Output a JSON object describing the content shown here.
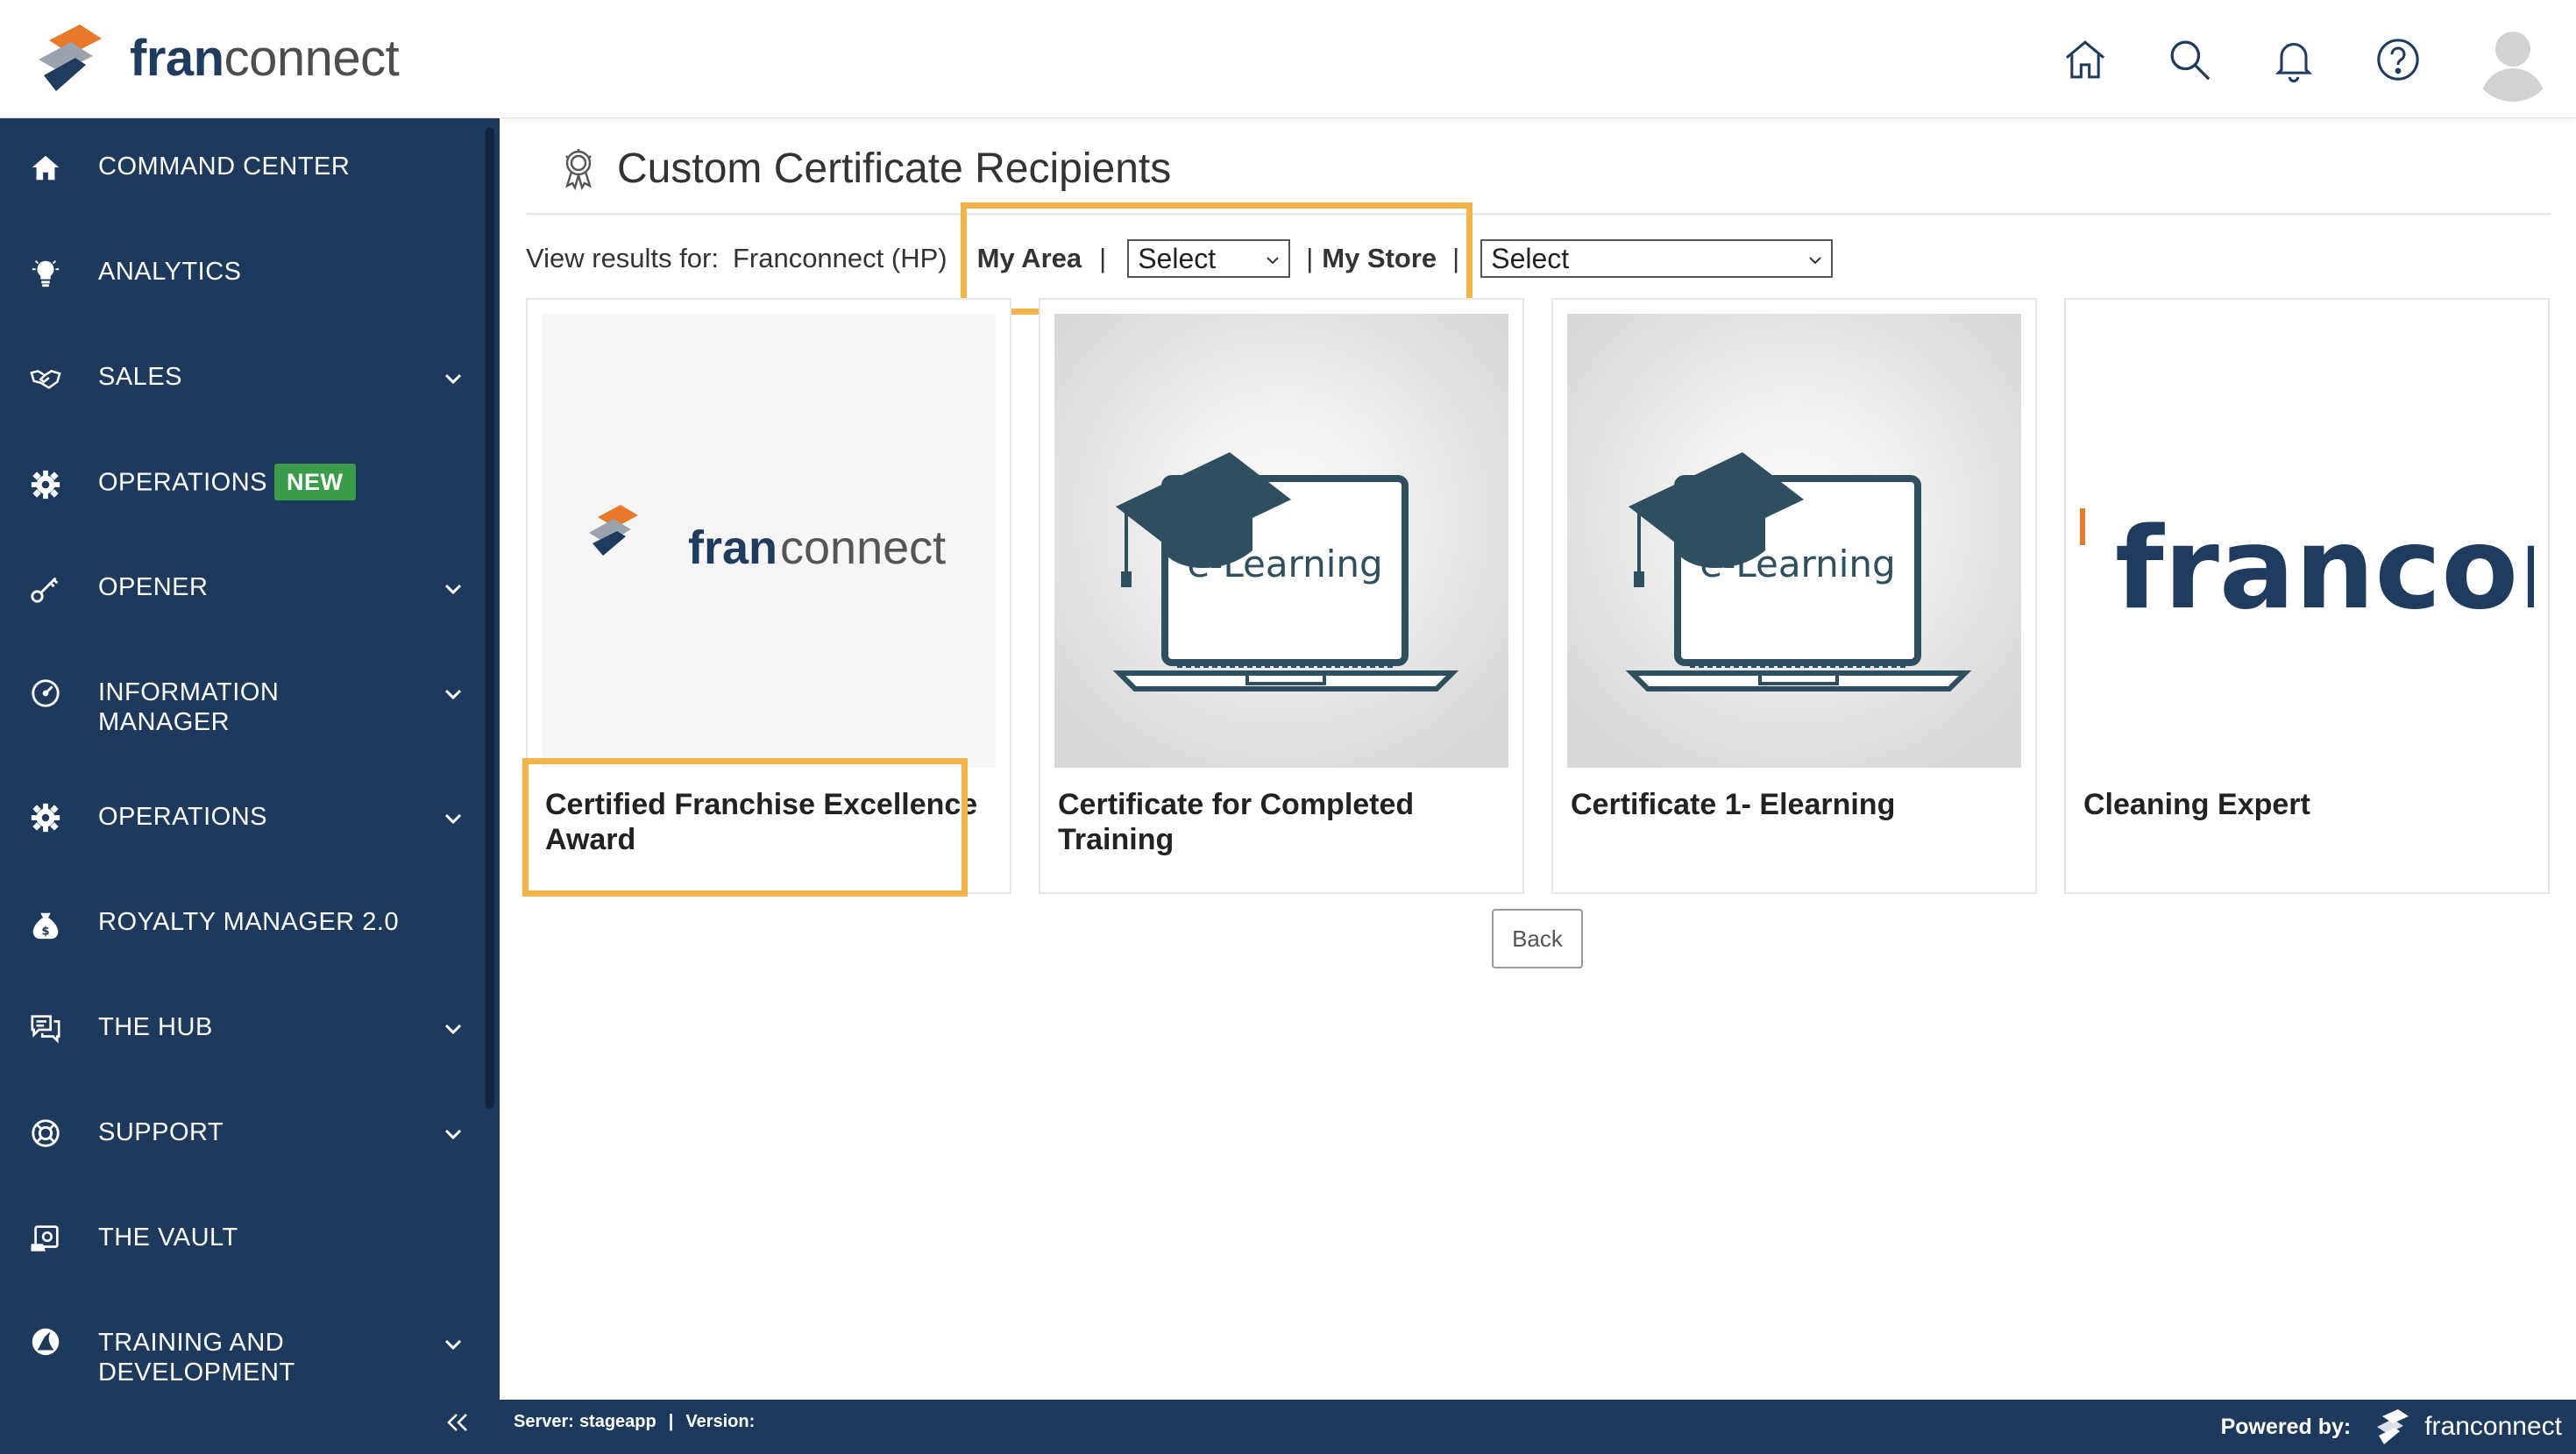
{
  "brand": {
    "logo_text_a": "fran",
    "logo_text_b": "connect"
  },
  "header": {
    "icons": [
      "home-icon",
      "search-icon",
      "bell-icon",
      "help-icon",
      "user-avatar"
    ]
  },
  "sidebar": {
    "items": [
      {
        "label": "COMMAND CENTER",
        "icon": "home-icon",
        "has_chevron": false
      },
      {
        "label": "ANALYTICS",
        "icon": "lightbulb-icon",
        "has_chevron": false
      },
      {
        "label": "SALES",
        "icon": "handshake-icon",
        "has_chevron": true
      },
      {
        "label": "OPERATIONS",
        "icon": "gear-icon",
        "has_chevron": false,
        "badge": "NEW"
      },
      {
        "label": "OPENER",
        "icon": "key-icon",
        "has_chevron": true
      },
      {
        "label": "INFORMATION",
        "label2": "MANAGER",
        "icon": "gauge-icon",
        "has_chevron": true
      },
      {
        "label": "OPERATIONS",
        "icon": "gear-icon",
        "has_chevron": true
      },
      {
        "label": "ROYALTY MANAGER 2.0",
        "icon": "money-bag-icon",
        "has_chevron": false
      },
      {
        "label": "THE HUB",
        "icon": "chat-icon",
        "has_chevron": true
      },
      {
        "label": "SUPPORT",
        "icon": "lifebuoy-icon",
        "has_chevron": true
      },
      {
        "label": "THE VAULT",
        "icon": "vault-icon",
        "has_chevron": false
      },
      {
        "label": "TRAINING AND",
        "label2": "DEVELOPMENT",
        "icon": "training-icon",
        "has_chevron": true
      }
    ],
    "collapse_glyph": "«"
  },
  "page": {
    "title": "Custom Certificate Recipients",
    "filter": {
      "view_label": "View results for:",
      "org": "Franconnect (HP)",
      "sep": "|",
      "area_label": "My Area",
      "area_value": "Select",
      "store_label": "My Store",
      "store_value": "Select"
    },
    "cards": [
      {
        "title": "Certified Franchise Excellence Award",
        "image": "franconnect-logo"
      },
      {
        "title": "Certificate for Completed Training",
        "image": "e-learning",
        "image_text": "e-Learning"
      },
      {
        "title": "Certificate 1- Elearning",
        "image": "e-learning",
        "image_text": "e-Learning"
      },
      {
        "title": "Cleaning Expert",
        "image": "franconnect-logo-cropped",
        "image_text": "franconi"
      }
    ],
    "back_label": "Back"
  },
  "footer": {
    "server_label": "Server:",
    "server_value": "stageapp",
    "sep": "|",
    "version_label": "Version:",
    "powered_label": "Powered by:",
    "powered_brand": "franconnect"
  },
  "colors": {
    "sidebar_bg": "#1d3a5c",
    "badge_green": "#3a9b4b",
    "highlight_orange": "#f4b24a",
    "logo_orange": "#e8792b",
    "logo_navy": "#1f3b5e"
  }
}
